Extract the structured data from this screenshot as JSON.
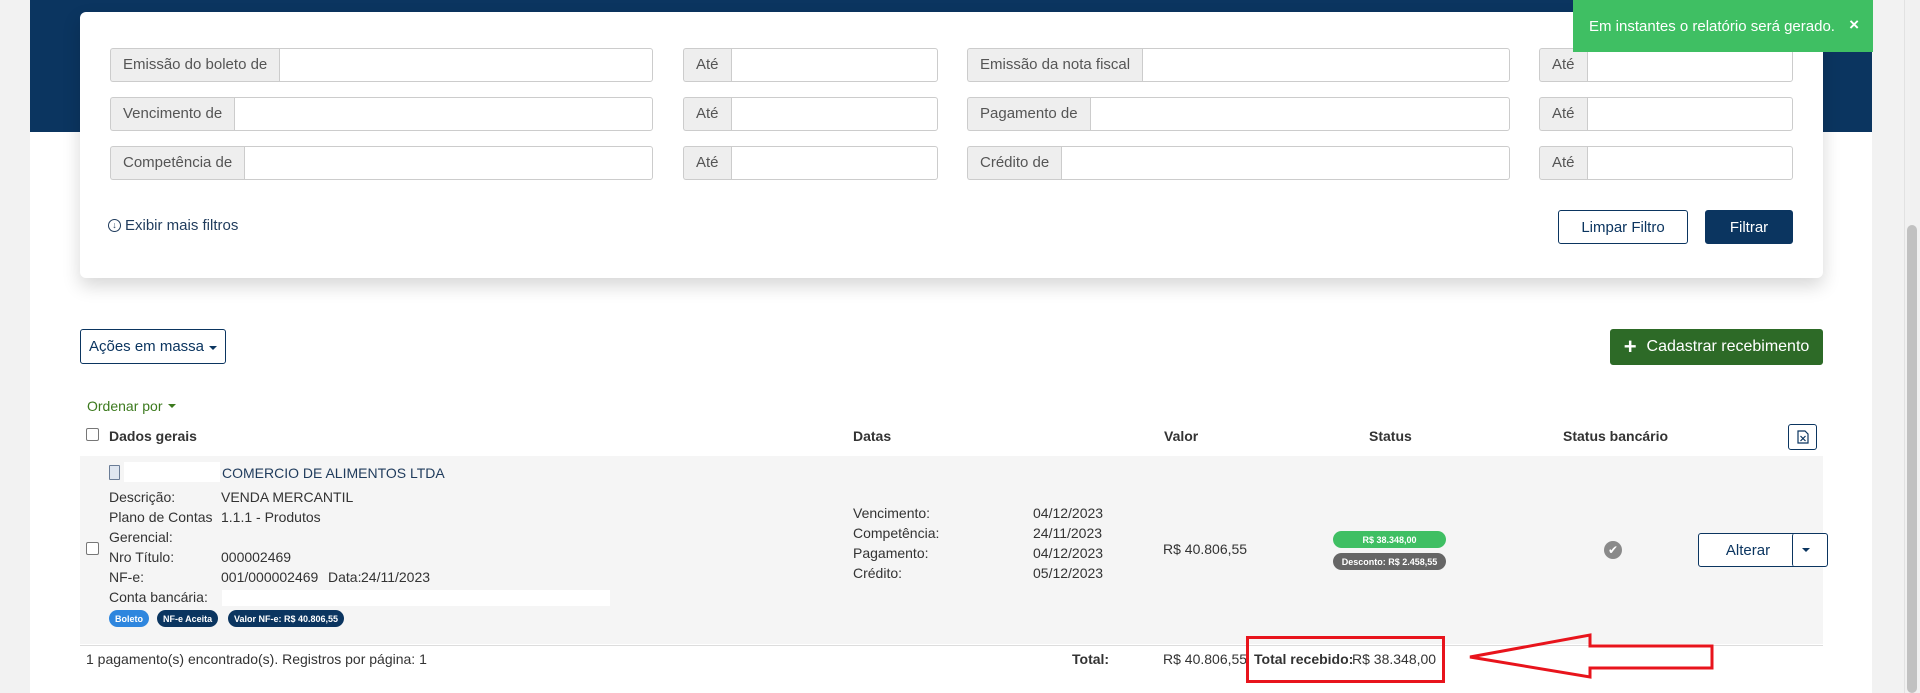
{
  "toast": {
    "message": "Em instantes o relatório será gerado.",
    "close": "×"
  },
  "filters": {
    "rows": [
      {
        "from_label": "Emissão do boleto de",
        "to_label": "Até",
        "from2_label": "Emissão da nota fiscal",
        "to2_label": "Até"
      },
      {
        "from_label": "Vencimento de",
        "to_label": "Até",
        "from2_label": "Pagamento de",
        "to2_label": "Até"
      },
      {
        "from_label": "Competência de",
        "to_label": "Até",
        "from2_label": "Crédito de",
        "to2_label": "Até"
      }
    ],
    "more_filters": "Exibir mais filtros",
    "clear_button": "Limpar Filtro",
    "filter_button": "Filtrar"
  },
  "actions": {
    "mass_actions": "Ações em massa",
    "add_button": "Cadastrar recebimento",
    "order_by": "Ordenar por"
  },
  "table": {
    "headers": {
      "general": "Dados gerais",
      "dates": "Datas",
      "value": "Valor",
      "status": "Status",
      "bank_status": "Status bancário"
    },
    "row": {
      "company": "COMERCIO DE ALIMENTOS LTDA",
      "fields": {
        "descricao_label": "Descrição:",
        "descricao_value": "VENDA MERCANTIL",
        "plano_label": "Plano de Contas",
        "plano_value": "1.1.1 - Produtos",
        "gerencial_label": "Gerencial:",
        "nro_label": "Nro Título:",
        "nro_value": "000002469",
        "nfe_label": "NF-e:",
        "nfe_value": "001/000002469",
        "nfe_date_label": "Data:",
        "nfe_date_value": "24/11/2023",
        "conta_label": "Conta bancária:"
      },
      "badges": {
        "boleto": "Boleto",
        "nfe": "NF-e Aceita",
        "valor_nfe": "Valor NF-e: R$ 40.806,55"
      },
      "dates": {
        "venc_label": "Vencimento:",
        "venc_value": "04/12/2023",
        "comp_label": "Competência:",
        "comp_value": "24/11/2023",
        "pag_label": "Pagamento:",
        "pag_value": "04/12/2023",
        "cred_label": "Crédito:",
        "cred_value": "05/12/2023"
      },
      "value": "R$ 40.806,55",
      "status_paid": "R$ 38.348,00",
      "status_discount": "Desconto: R$ 2.458,55",
      "edit_button": "Alterar"
    }
  },
  "footer": {
    "summary": "1 pagamento(s) encontrado(s). Registros por página: 1",
    "total_label": "Total:",
    "total_value": "R$ 40.806,55",
    "received_label": "Total recebido:",
    "received_value": "R$ 38.348,00"
  },
  "colors": {
    "navy": "#0b3560",
    "toast_green": "#3fbf63",
    "add_green": "#2d6a27",
    "badge_blue": "#2e86de",
    "highlight_red": "#e8141c"
  }
}
